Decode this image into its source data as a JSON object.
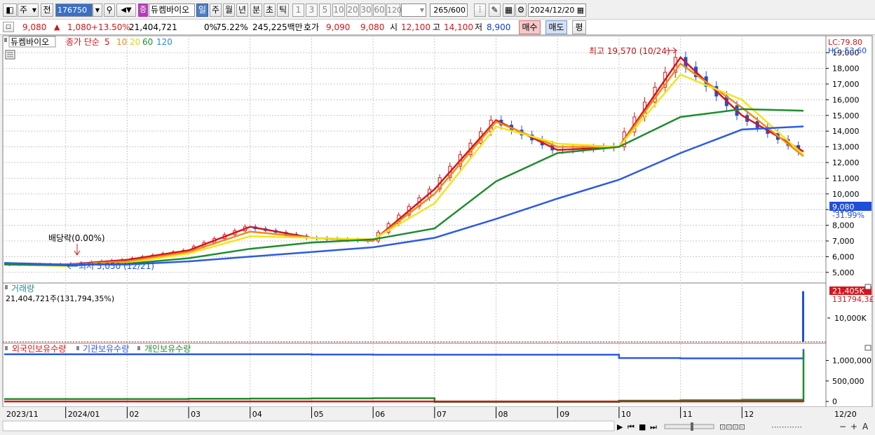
{
  "toolbar": {
    "period_label": "주",
    "prev_label": "전",
    "code_value": "176750",
    "type_badge": "증",
    "stock_name": "듀켐바이오",
    "timeframes": [
      "일",
      "주",
      "월",
      "년",
      "분",
      "초",
      "틱"
    ],
    "active_timeframe": "일",
    "intervals": [
      "1",
      "3",
      "5",
      "10",
      "20",
      "30",
      "60",
      "120"
    ],
    "count_value": "265",
    "count_total": "/600",
    "date_value": "2024/12/20"
  },
  "quote": {
    "price": "9,080",
    "change_arrow": "▲",
    "change": "1,080",
    "change_pct": "+13.50%",
    "volume": "21,404,721",
    "ratio1": "0%",
    "ratio2": "75.22%",
    "amount": "245,225백만",
    "bid_label": "호가",
    "bid": "9,090",
    "ask": "9,080",
    "open_label": "시",
    "open": "12,100",
    "high_label": "고",
    "high": "14,100",
    "low_label": "저",
    "low": "8,900",
    "buy_label": "매수",
    "sell_label": "매도",
    "eval_label": "평"
  },
  "legend": {
    "name": "듀켐바이오",
    "ma_prefix": "종가 단순",
    "ma_periods": [
      "5",
      "10",
      "20",
      "60",
      "120"
    ]
  },
  "annotations": {
    "high": "최고 19,570 (10/24)",
    "low": "최저 5,050 (12/21)",
    "dividend": "배당락(0.00%)",
    "lc": "LC:79.80",
    "hc": "HC:-53.60",
    "current_price": "9,080",
    "current_pct": "-31.99%"
  },
  "volume_panel": {
    "title": "거래량",
    "summary": "21,404,721주(131,794,35%)",
    "badge_top": "21,405K",
    "badge_bottom": "131794,3£",
    "axis_label": "10,000K"
  },
  "holdings_panel": {
    "legend": [
      "외국인보유수량",
      "기관보유수량",
      "개인보유수량"
    ],
    "axis_labels": [
      "1,000,000",
      "500,000",
      "0"
    ]
  },
  "xaxis": {
    "labels": [
      "2023/11",
      "2024/01",
      "02",
      "03",
      "04",
      "05",
      "06",
      "07",
      "08",
      "09",
      "10",
      "11",
      "12"
    ],
    "end_label": "12/20"
  },
  "colors": {
    "up": "#d7141a",
    "down": "#1f4fd8",
    "ma5": "#d7141a",
    "ma10": "#ee8a1a",
    "ma20": "#f2e41b",
    "ma60": "#1e8c2e",
    "ma120": "#2d5be3",
    "vol_badge": "#d7141a"
  },
  "chart_data": {
    "type": "line",
    "title": "듀켐바이오",
    "ylim": [
      4500,
      19900
    ],
    "y_ticks": [
      5000,
      6000,
      7000,
      8000,
      9000,
      10000,
      11000,
      12000,
      13000,
      14000,
      15000,
      16000,
      17000,
      18000,
      19000
    ],
    "x": [
      "2023/11",
      "2024/01",
      "02",
      "03",
      "04",
      "05",
      "06",
      "07",
      "08",
      "09",
      "10",
      "11",
      "12",
      "12/20"
    ],
    "series": [
      {
        "name": "5",
        "values": [
          5500,
          5500,
          5800,
          6400,
          7900,
          7200,
          7000,
          10300,
          14700,
          12800,
          13000,
          18700,
          15000,
          12700
        ]
      },
      {
        "name": "10",
        "values": [
          5500,
          5500,
          5700,
          6300,
          7600,
          7200,
          7000,
          10000,
          14600,
          13000,
          13000,
          18300,
          15500,
          12400
        ]
      },
      {
        "name": "20",
        "values": [
          5500,
          5400,
          5600,
          6200,
          7300,
          7200,
          7100,
          9400,
          14300,
          13200,
          13000,
          17600,
          16000,
          12500
        ]
      },
      {
        "name": "60",
        "values": [
          5500,
          5450,
          5550,
          5900,
          6500,
          6900,
          7100,
          7800,
          10800,
          12600,
          13000,
          14900,
          15400,
          15300
        ]
      },
      {
        "name": "120",
        "values": [
          5600,
          5500,
          5500,
          5700,
          6000,
          6300,
          6600,
          7200,
          8400,
          9700,
          10900,
          12600,
          14100,
          14300
        ]
      }
    ],
    "volume_ylim": [
      0,
      24000000
    ],
    "volume_last": 21404721,
    "holdings": {
      "ylim": [
        -100000,
        1300000
      ],
      "foreign": [
        0,
        0,
        0,
        0,
        0,
        0,
        0,
        0,
        0,
        0,
        0,
        0,
        0,
        -10000
      ],
      "institution": [
        1150000,
        1150000,
        1150000,
        1150000,
        1150000,
        1145000,
        1140000,
        1140000,
        1140000,
        1140000,
        1060000,
        1050000,
        1050000,
        1280000
      ],
      "individual": [
        60000,
        60000,
        60000,
        65000,
        70000,
        75000,
        80000,
        -10000,
        -10000,
        -10000,
        20000,
        30000,
        40000,
        1200000
      ]
    }
  }
}
